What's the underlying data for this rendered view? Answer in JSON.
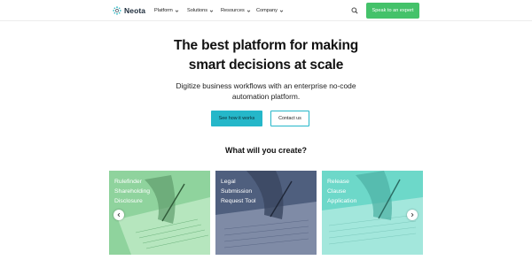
{
  "nav": {
    "logo_text": "Neota",
    "menu": [
      {
        "label": "Platform"
      },
      {
        "label": "Solutions"
      },
      {
        "label": "Resources"
      },
      {
        "label": "Company"
      }
    ],
    "cta_label": "Speak to an expert"
  },
  "hero": {
    "title_line1": "The best platform for making",
    "title_line2": "smart decisions at scale",
    "subtitle_line1": "Digitize business workflows with an enterprise no-code",
    "subtitle_line2": "automation platform.",
    "primary_button": "See how it works",
    "secondary_button": "Contact us"
  },
  "carousel": {
    "heading": "What will you create?",
    "cards": [
      {
        "lines": [
          "Rulefinder",
          "Shareholding",
          "Disclosure"
        ],
        "color": "#8fd39d"
      },
      {
        "lines": [
          "Legal",
          "Submission",
          "Request Tool"
        ],
        "color": "#4f5f7e"
      },
      {
        "lines": [
          "Release",
          "Clause",
          "Application"
        ],
        "color": "#6dd8c9"
      }
    ]
  },
  "colors": {
    "accent_green": "#44c26a",
    "accent_teal": "#25b7c9"
  },
  "icons": {
    "logo": "neota-logo-icon",
    "chevron": "chevron-down-icon",
    "search": "search-icon",
    "prev": "chevron-left-icon",
    "next": "chevron-right-icon"
  }
}
